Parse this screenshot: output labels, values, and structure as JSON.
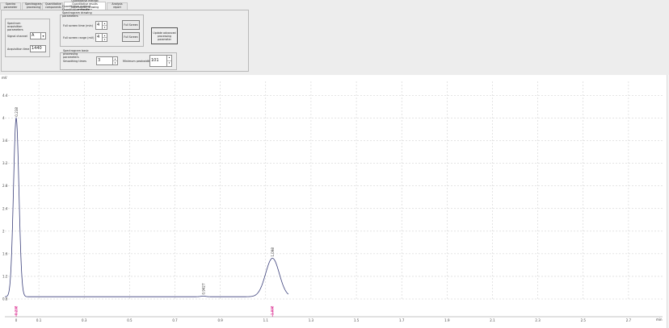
{
  "tabs": [
    {
      "label": "Spectra parameter",
      "active": false
    },
    {
      "label": "Spectrogram processing",
      "active": false
    },
    {
      "label": "Quantitative components",
      "active": false
    },
    {
      "label": "Quantitative method Quantitative results Spectrogram drawing parameters",
      "active": true
    },
    {
      "label": "Analysis report",
      "active": false
    }
  ],
  "acquisition": {
    "group_label": "Spectrum acquisition parameters",
    "signal_channel_label": "Signal channel",
    "signal_channel_value": "A",
    "acquisition_time_label": "Acquisition time",
    "acquisition_time_value": "1440"
  },
  "drawing": {
    "full_screen_time_label": "Full screen time (min)",
    "full_screen_time_value": "4",
    "full_screen_range_label": "Full screen range (mV)",
    "full_screen_range_value": "4",
    "full_screen_button_1": "Full Screen",
    "full_screen_button_2": "Full Screen",
    "update_button": "Update advanced processing parameter"
  },
  "processing": {
    "group_label": "Spectrogram basic processing parameters",
    "smoothing_label": "Smoothing times",
    "smoothing_value": "3",
    "min_peak_label": "Minimum peakwidth",
    "min_peak_value": "101"
  },
  "chart_data": {
    "type": "line",
    "ylabel": "mV",
    "xlabel": "min",
    "xlim": [
      -0.05,
      2.85
    ],
    "ylim": [
      0.8,
      4.65
    ],
    "x_ticks": [
      0.0,
      0.1,
      0.3,
      0.5,
      0.7,
      0.9,
      1.1,
      1.3,
      1.5,
      1.7,
      1.9,
      2.1,
      2.3,
      2.5,
      2.7
    ],
    "x_tick_labels": [
      "0",
      "0.1",
      "0.3",
      "0.5",
      "0.7",
      "0.9",
      "1.1",
      "1.3",
      "1.5",
      "1.7",
      "1.9",
      "2.1",
      "2.3",
      "2.5",
      "2.7"
    ],
    "y_ticks": [
      0.8,
      1.2,
      1.6,
      2.0,
      2.4,
      2.8,
      3.2,
      3.6,
      4.0,
      4.4
    ],
    "y_tick_labels": [
      "0.8",
      "1.2",
      "1.6",
      "2",
      "2.4",
      "2.8",
      "3.2",
      "3.6",
      "4",
      "4.4"
    ],
    "grid": true,
    "baseline": 0.84,
    "line_color": "#3a3f7a",
    "marker_color": "#d4007a",
    "peaks": [
      {
        "x": 0.0,
        "height": 4.0,
        "width": 0.012,
        "label": "0.238"
      },
      {
        "x": 0.825,
        "height": 0.85,
        "width": 0.012,
        "label": "0.9427"
      },
      {
        "x": 1.13,
        "height": 1.52,
        "width": 0.03,
        "label": "1.098"
      }
    ],
    "x_end": 1.2,
    "markers": [
      {
        "x": 0.0,
        "label": "0.238"
      },
      {
        "x": 1.13,
        "label": "1.098"
      }
    ]
  }
}
